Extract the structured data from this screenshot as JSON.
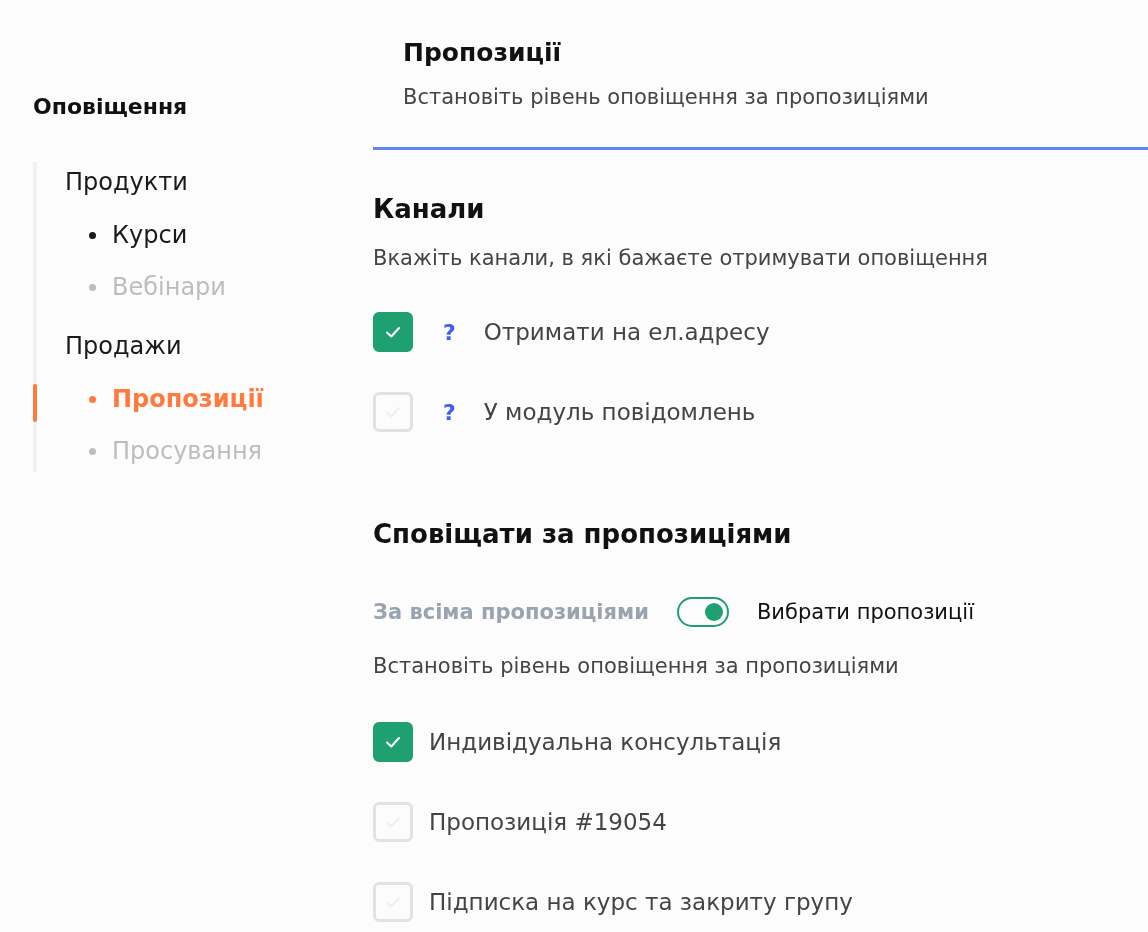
{
  "sidebar": {
    "title": "Оповіщення",
    "groups": [
      {
        "label": "Продукти",
        "children": [
          {
            "label": "Курси",
            "selected": false,
            "disabled": false
          },
          {
            "label": "Вебінари",
            "selected": false,
            "disabled": true
          }
        ]
      },
      {
        "label": "Продажи",
        "children": [
          {
            "label": "Пропозиції",
            "selected": true,
            "disabled": false
          },
          {
            "label": "Просування",
            "selected": false,
            "disabled": true
          }
        ]
      }
    ]
  },
  "header": {
    "title": "Пропозиції",
    "subtitle": "Встановіть рівень оповіщення за пропозиціями"
  },
  "channels": {
    "title": "Канали",
    "description": "Вкажіть канали, в які бажаєте отримувати оповіщення",
    "help_icon": "?",
    "items": [
      {
        "label": "Отримати на ел.адресу",
        "checked": true
      },
      {
        "label": "У модуль повідомлень",
        "checked": false
      }
    ]
  },
  "offers": {
    "title": "Сповіщати за пропозиціями",
    "toggle": {
      "off_label": "За всіма пропозиціями",
      "on_label": "Вибрати пропозиції",
      "on": true
    },
    "description": "Встановіть рівень оповіщення за пропозиціями",
    "items": [
      {
        "label": "Индивідуальна консультація",
        "checked": true
      },
      {
        "label": "Пропозиція #19054",
        "checked": false
      },
      {
        "label": "Підписка на курс та закриту групу",
        "checked": false
      }
    ]
  }
}
